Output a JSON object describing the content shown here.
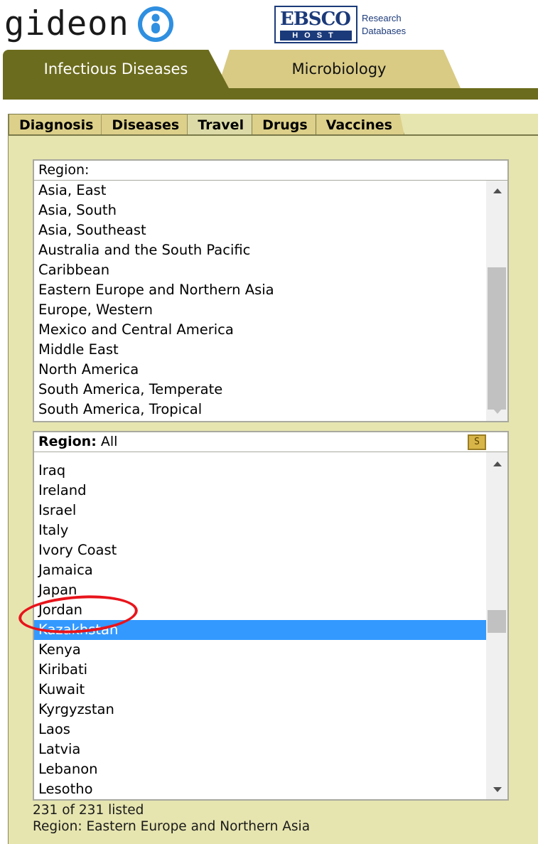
{
  "header": {
    "logo_text": "gideon",
    "ebsco_logo": {
      "top_text": "EBSCO",
      "bottom_text": "HOST",
      "side_text_1": "Research",
      "side_text_2": "Databases"
    },
    "main_tabs": [
      {
        "label": "Infectious Diseases",
        "active": true
      },
      {
        "label": "Microbiology",
        "active": false
      }
    ]
  },
  "sub_tabs": [
    {
      "label": "Diagnosis",
      "active": false
    },
    {
      "label": "Diseases",
      "active": false
    },
    {
      "label": "Travel",
      "active": true
    },
    {
      "label": "Drugs",
      "active": false
    },
    {
      "label": "Vaccines",
      "active": false
    }
  ],
  "region_list": {
    "heading": "Region:",
    "items": [
      "Asia, East",
      "Asia, South",
      "Asia, Southeast",
      "Australia and the South Pacific",
      "Caribbean",
      "Eastern Europe and Northern Asia",
      "Europe, Western",
      "Mexico and Central America",
      "Middle East",
      "North America",
      "South America, Temperate",
      "South America, Tropical"
    ]
  },
  "country_list": {
    "heading_label": "Region:",
    "heading_value": "All",
    "search_button_label": "S",
    "items": [
      "Iraq",
      "Ireland",
      "Israel",
      "Italy",
      "Ivory Coast",
      "Jamaica",
      "Japan",
      "Jordan",
      "Kazakhstan",
      "Kenya",
      "Kiribati",
      "Kuwait",
      "Kyrgyzstan",
      "Laos",
      "Latvia",
      "Lebanon",
      "Lesotho"
    ],
    "selected": "Kazakhstan"
  },
  "footer": {
    "count_text": "231 of 231 listed",
    "region_text": "Region: Eastern Europe and Northern Asia"
  },
  "colors": {
    "brand_olive": "#6c6c1e",
    "tab_tan": "#d9cb84",
    "panel_bg": "#e6e5b0",
    "selection_blue": "#3399ff",
    "annotation_red": "#e8141b"
  }
}
